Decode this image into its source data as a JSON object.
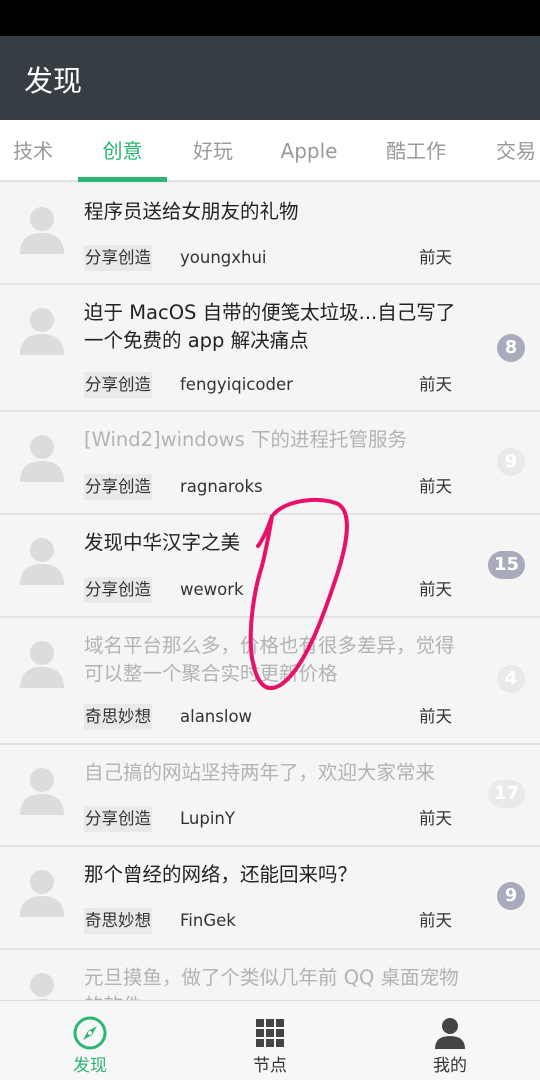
{
  "appbar": {
    "title": "发现"
  },
  "tabs": [
    {
      "label": "技术",
      "active": false
    },
    {
      "label": "创意",
      "active": true
    },
    {
      "label": "好玩",
      "active": false
    },
    {
      "label": "Apple",
      "active": false
    },
    {
      "label": "酷工作",
      "active": false
    },
    {
      "label": "交易",
      "active": false
    }
  ],
  "topics": [
    {
      "title": "程序员送给女朋友的礼物",
      "node": "分享创造",
      "author": "youngxhui",
      "time": "前天",
      "replies": "",
      "read": false
    },
    {
      "title": "迫于 MacOS 自带的便笺太垃圾...自己写了一个免费的 app 解决痛点",
      "node": "分享创造",
      "author": "fengyiqicoder",
      "time": "前天",
      "replies": "8",
      "read": false
    },
    {
      "title": "[Wind2]windows 下的进程托管服务",
      "node": "分享创造",
      "author": "ragnaroks",
      "time": "前天",
      "replies": "9",
      "read": true
    },
    {
      "title": "发现中华汉字之美",
      "node": "分享创造",
      "author": "wework",
      "time": "前天",
      "replies": "15",
      "read": false
    },
    {
      "title": "域名平台那么多，价格也有很多差异，觉得可以整一个聚合实时更新价格",
      "node": "奇思妙想",
      "author": "alanslow",
      "time": "前天",
      "replies": "4",
      "read": true
    },
    {
      "title": "自己搞的网站坚持两年了，欢迎大家常来",
      "node": "分享创造",
      "author": "LupinY",
      "time": "前天",
      "replies": "17",
      "read": true
    },
    {
      "title": "那个曾经的网络，还能回来吗？",
      "node": "奇思妙想",
      "author": "FinGek",
      "time": "前天",
      "replies": "9",
      "read": false
    },
    {
      "title": "元旦摸鱼，做了个类似几年前 QQ 桌面宠物的软件",
      "node": "",
      "author": "",
      "time": "",
      "replies": "",
      "read": true
    }
  ],
  "bottom_nav": [
    {
      "label": "发现",
      "icon": "compass-icon",
      "active": true
    },
    {
      "label": "节点",
      "icon": "grid-icon",
      "active": false
    },
    {
      "label": "我的",
      "icon": "person-icon",
      "active": false
    }
  ],
  "colors": {
    "accent": "#2bb673",
    "appbar": "#363d43",
    "badge": "#a9abbc",
    "annotation": "#e8106a"
  }
}
